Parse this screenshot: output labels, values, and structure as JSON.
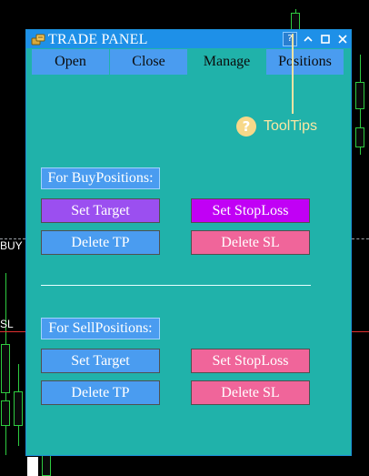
{
  "background": {
    "left_labels": {
      "buy": "BUY (",
      "sl": "SL"
    }
  },
  "window": {
    "title": "TRADE PANEL",
    "icon": "coins-icon",
    "controls": {
      "help": "?",
      "minimize": "⌃",
      "maximize": "◻",
      "close": "✕"
    }
  },
  "tabs": [
    {
      "label": "Open",
      "active": false
    },
    {
      "label": "Close",
      "active": false
    },
    {
      "label": "Manage",
      "active": true
    },
    {
      "label": "Positions",
      "active": false
    }
  ],
  "tooltip": {
    "badge": "?",
    "label": "ToolTips"
  },
  "buy": {
    "heading": "For BuyPositions:",
    "set_target": "Set Target",
    "set_stoploss": "Set StopLoss",
    "delete_tp": "Delete TP",
    "delete_sl": "Delete SL"
  },
  "sell": {
    "heading": "For SellPositions:",
    "set_target": "Set Target",
    "set_stoploss": "Set StopLoss",
    "delete_tp": "Delete TP",
    "delete_sl": "Delete SL"
  },
  "colors": {
    "panel_bg": "#20b2aa",
    "tab_bg": "#4a9cf0",
    "buy_target": "#9b4ff0",
    "buy_stoploss": "#c100f5",
    "blue_btn": "#4a9cf0",
    "pink_btn": "#f0659a"
  }
}
